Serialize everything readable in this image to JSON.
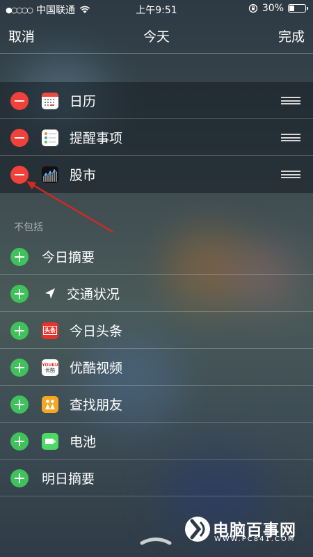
{
  "status_bar": {
    "signal": "●○○○○",
    "carrier": "中国联通",
    "time": "上午9:51",
    "battery": "30%",
    "battery_level": 0.3
  },
  "nav": {
    "cancel": "取消",
    "title": "今天",
    "done": "完成"
  },
  "included": [
    {
      "label": "日历",
      "icon": "calendar-icon"
    },
    {
      "label": "提醒事项",
      "icon": "reminders-icon"
    },
    {
      "label": "股市",
      "icon": "stocks-icon"
    }
  ],
  "section_title": "不包括",
  "excluded": [
    {
      "label": "今日摘要",
      "icon": null
    },
    {
      "label": "交通状况",
      "icon": "location-arrow-icon"
    },
    {
      "label": "今日头条",
      "icon": "toutiao-icon",
      "icon_text": "头条"
    },
    {
      "label": "优酷视频",
      "icon": "youku-icon",
      "icon_text": "YOUKU",
      "icon_subtext": "优酷"
    },
    {
      "label": "查找朋友",
      "icon": "find-friends-icon"
    },
    {
      "label": "电池",
      "icon": "battery-app-icon"
    },
    {
      "label": "明日摘要",
      "icon": null
    }
  ],
  "watermark": {
    "text": "电脑百事网",
    "url_text": "WWW.PC841.COM"
  },
  "colors": {
    "remove": "#f2403a",
    "add": "#3fc25b",
    "arrow": "#d8281e"
  }
}
